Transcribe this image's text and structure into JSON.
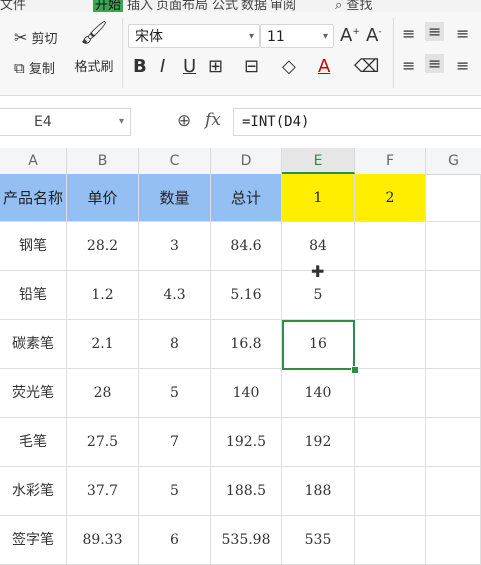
{
  "menu": {
    "items": [
      "文件",
      "开始",
      "插入",
      "页面布局",
      "公式",
      "数据",
      "审阅",
      "查找"
    ]
  },
  "ribbon": {
    "cut": "剪切",
    "copy": "复制",
    "format_painter": "格式刷",
    "font_name": "宋体",
    "font_size": "11"
  },
  "formula_bar": {
    "name_box": "E4",
    "fx": "fx",
    "formula": "=INT(D4)"
  },
  "columns": [
    "A",
    "B",
    "C",
    "D",
    "E",
    "F",
    "G"
  ],
  "header_row": [
    "产品名称",
    "单价",
    "数量",
    "总计",
    "1",
    "2"
  ],
  "rows": [
    [
      "钢笔",
      "28.2",
      "3",
      "84.6",
      "84"
    ],
    [
      "铅笔",
      "1.2",
      "4.3",
      "5.16",
      "5"
    ],
    [
      "碳素笔",
      "2.1",
      "8",
      "16.8",
      "16"
    ],
    [
      "荧光笔",
      "28",
      "5",
      "140",
      "140"
    ],
    [
      "毛笔",
      "27.5",
      "7",
      "192.5",
      "192"
    ],
    [
      "水彩笔",
      "37.7",
      "5",
      "188.5",
      "188"
    ],
    [
      "签字笔",
      "89.33",
      "6",
      "535.98",
      "535"
    ]
  ],
  "active_cell": "E4",
  "colors": {
    "header_blue": "#94bff3",
    "header_yellow": "#ffee00",
    "selection_green": "#2f8d4a"
  }
}
